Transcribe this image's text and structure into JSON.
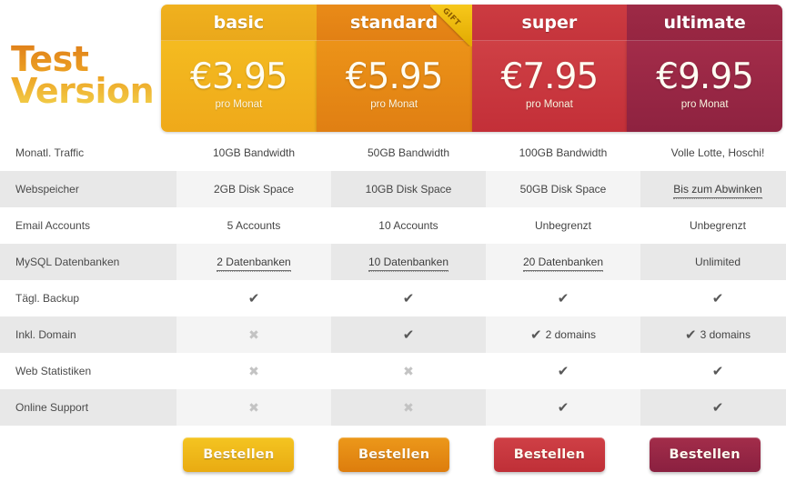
{
  "brand": {
    "line1": "Test",
    "line2": "Version"
  },
  "plans": [
    {
      "key": "basic",
      "name": "basic",
      "price": "€3.95",
      "period": "pro Monat",
      "order_label": "Bestellen",
      "ribbon": null,
      "color": "#f4bb20"
    },
    {
      "key": "standard",
      "name": "standard",
      "price": "€5.95",
      "period": "pro Monat",
      "order_label": "Bestellen",
      "ribbon": "GIFT",
      "color": "#ec9318"
    },
    {
      "key": "super",
      "name": "super",
      "price": "€7.95",
      "period": "pro Monat",
      "order_label": "Bestellen",
      "ribbon": null,
      "color": "#cf4045"
    },
    {
      "key": "ultimate",
      "name": "ultimate",
      "price": "€9.95",
      "period": "pro Monat",
      "order_label": "Bestellen",
      "ribbon": null,
      "color": "#a32c49"
    }
  ],
  "features": [
    {
      "label": "Monatl. Traffic",
      "cells": [
        {
          "type": "text",
          "text": "10GB Bandwidth"
        },
        {
          "type": "text",
          "text": "50GB Bandwidth"
        },
        {
          "type": "text",
          "text": "100GB Bandwidth"
        },
        {
          "type": "text",
          "text": "Volle Lotte, Hoschi!"
        }
      ]
    },
    {
      "label": "Webspeicher",
      "cells": [
        {
          "type": "text",
          "text": "2GB Disk Space"
        },
        {
          "type": "text",
          "text": "10GB Disk Space"
        },
        {
          "type": "text",
          "text": "50GB Disk Space"
        },
        {
          "type": "tip",
          "text": "Bis zum Abwinken"
        }
      ]
    },
    {
      "label": "Email Accounts",
      "cells": [
        {
          "type": "text",
          "text": "5 Accounts"
        },
        {
          "type": "text",
          "text": "10 Accounts"
        },
        {
          "type": "text",
          "text": "Unbegrenzt"
        },
        {
          "type": "text",
          "text": "Unbegrenzt"
        }
      ]
    },
    {
      "label": "MySQL Datenbanken",
      "cells": [
        {
          "type": "tip",
          "text": "2 Datenbanken"
        },
        {
          "type": "tip",
          "text": "10 Datenbanken"
        },
        {
          "type": "tip",
          "text": "20 Datenbanken"
        },
        {
          "type": "text",
          "text": "Unlimited"
        }
      ]
    },
    {
      "label": "Tägl. Backup",
      "cells": [
        {
          "type": "yes",
          "text": "✔"
        },
        {
          "type": "yes",
          "text": "✔"
        },
        {
          "type": "yes",
          "text": "✔"
        },
        {
          "type": "yes",
          "text": "✔"
        }
      ]
    },
    {
      "label": "Inkl. Domain",
      "cells": [
        {
          "type": "no",
          "text": "✖"
        },
        {
          "type": "yes",
          "text": "✔"
        },
        {
          "type": "yes-text",
          "text": "2 domains",
          "mark": "✔"
        },
        {
          "type": "yes-text",
          "text": "3 domains",
          "mark": "✔"
        }
      ]
    },
    {
      "label": "Web Statistiken",
      "cells": [
        {
          "type": "no",
          "text": "✖"
        },
        {
          "type": "no",
          "text": "✖"
        },
        {
          "type": "yes",
          "text": "✔"
        },
        {
          "type": "yes",
          "text": "✔"
        }
      ]
    },
    {
      "label": "Online Support",
      "cells": [
        {
          "type": "no",
          "text": "✖"
        },
        {
          "type": "no",
          "text": "✖"
        },
        {
          "type": "yes",
          "text": "✔"
        },
        {
          "type": "yes",
          "text": "✔"
        }
      ]
    }
  ],
  "icons": {
    "check": "check-icon",
    "cross": "cross-icon"
  },
  "theme": {
    "basic": "#f4bb20",
    "standard": "#ec9318",
    "super": "#cf4045",
    "ultimate": "#a32c49",
    "stripe": "#e8e8e8",
    "stripe_alt": "#f4f4f4"
  }
}
